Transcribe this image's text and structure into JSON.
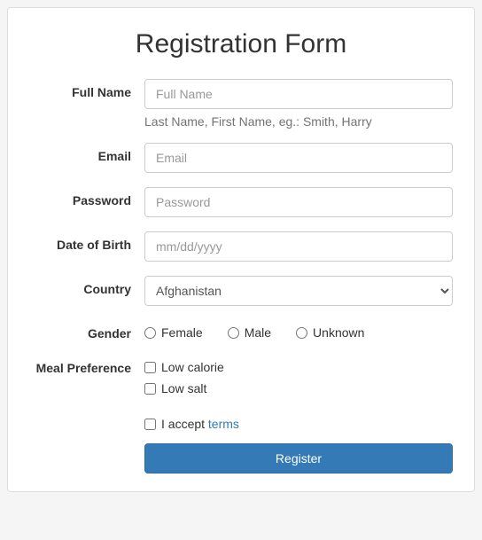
{
  "title": "Registration Form",
  "fields": {
    "fullName": {
      "label": "Full Name",
      "placeholder": "Full Name",
      "help": "Last Name, First Name, eg.: Smith, Harry"
    },
    "email": {
      "label": "Email",
      "placeholder": "Email"
    },
    "password": {
      "label": "Password",
      "placeholder": "Password"
    },
    "dob": {
      "label": "Date of Birth",
      "placeholder": "mm/dd/yyyy"
    },
    "country": {
      "label": "Country",
      "selected": "Afghanistan"
    },
    "gender": {
      "label": "Gender",
      "options": {
        "female": "Female",
        "male": "Male",
        "unknown": "Unknown"
      }
    },
    "meal": {
      "label": "Meal Preference",
      "options": {
        "lowCalorie": "Low calorie",
        "lowSalt": "Low salt"
      }
    },
    "terms": {
      "prefix": "I accept ",
      "link": "terms"
    }
  },
  "submit": "Register"
}
